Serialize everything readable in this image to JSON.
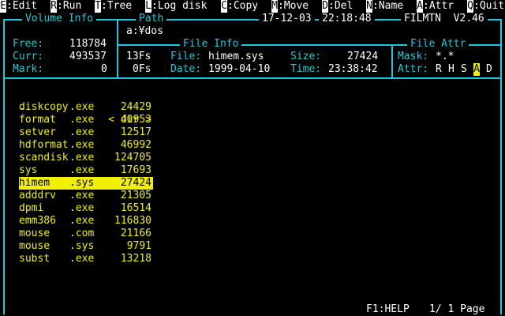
{
  "menu": [
    {
      "key": "E",
      "label": ":Edit"
    },
    {
      "key": "R",
      "label": ":Run"
    },
    {
      "key": "T",
      "label": ":Tree"
    },
    {
      "key": "L",
      "label": ":Log disk"
    },
    {
      "key": "C",
      "label": ":Copy"
    },
    {
      "key": "M",
      "label": ":Move"
    },
    {
      "key": "D",
      "label": ":Del"
    },
    {
      "key": "N",
      "label": ":Name"
    },
    {
      "key": "A",
      "label": ":Attr"
    },
    {
      "key": "Q",
      "label": ":Quit"
    }
  ],
  "volume": {
    "title": "Volume Info",
    "free_label": "Free:",
    "free_value": "118784",
    "curr_label": "Curr:",
    "curr_value": "493537",
    "curr_fs": "13Fs",
    "mark_label": "Mark:",
    "mark_value": "0",
    "mark_fs": "0Fs"
  },
  "path": {
    "title": "Path",
    "value": "a:¥dos"
  },
  "header": {
    "date": "17-12-03",
    "time": "22:18:48",
    "app": "FILMTN  V2.46"
  },
  "file_info": {
    "title": "File Info",
    "file_label": "File:",
    "file_value": "himem.sys",
    "size_label": "Size:",
    "size_value": "27424",
    "date_label": "Date:",
    "date_value": "1999-04-10",
    "time_label": "Time:",
    "time_value": "23:38:42"
  },
  "file_attr": {
    "title": "File Attr",
    "mask_label": "Mask:",
    "mask_value": "*.*",
    "attr_label": "Attr:",
    "attrs": [
      "R",
      "H",
      "S",
      "A",
      "D"
    ]
  },
  "parent": {
    "name": "..",
    "tag": "< dir >"
  },
  "files": [
    {
      "name": "diskcopy",
      "ext": ".exe",
      "size": "24429"
    },
    {
      "name": "format",
      "ext": ".exe",
      "size": "40953"
    },
    {
      "name": "setver",
      "ext": ".exe",
      "size": "12517"
    },
    {
      "name": "hdformat",
      "ext": ".exe",
      "size": "46992"
    },
    {
      "name": "scandisk",
      "ext": ".exe",
      "size": "124705"
    },
    {
      "name": "sys",
      "ext": ".exe",
      "size": "17693"
    },
    {
      "name": "himem",
      "ext": ".sys",
      "size": "27424"
    },
    {
      "name": "adddrv",
      "ext": ".exe",
      "size": "21305"
    },
    {
      "name": "dpmi",
      "ext": ".exe",
      "size": "16514"
    },
    {
      "name": "emm386",
      "ext": ".exe",
      "size": "116830"
    },
    {
      "name": "mouse",
      "ext": ".com",
      "size": "21166"
    },
    {
      "name": "mouse",
      "ext": ".sys",
      "size": "9791"
    },
    {
      "name": "subst",
      "ext": ".exe",
      "size": "13218"
    }
  ],
  "footer": {
    "help": "F1:HELP",
    "page": "1/ 1 Page"
  },
  "colors": {
    "frame": "#1ec8d8",
    "file": "#f0f000",
    "text": "#ffffff",
    "bg": "#000000"
  }
}
